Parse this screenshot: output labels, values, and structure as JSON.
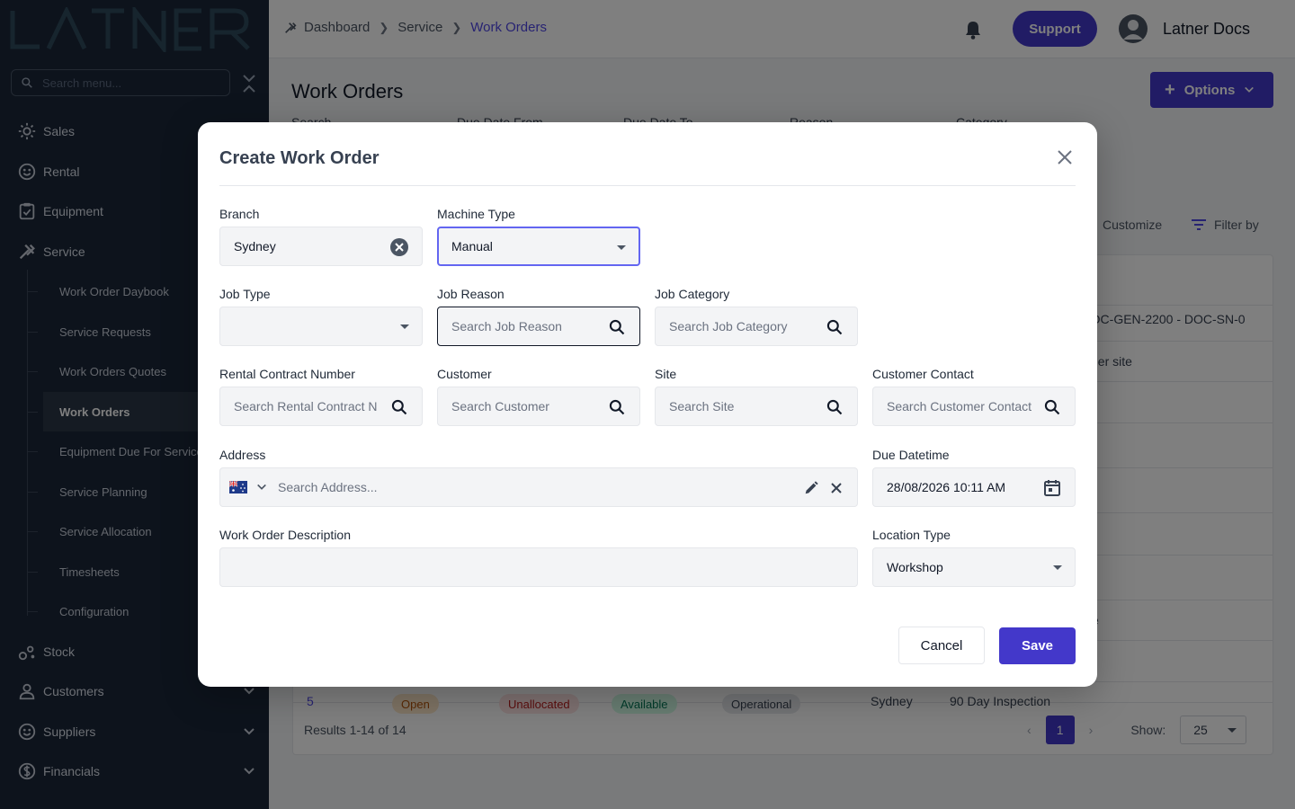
{
  "sidebar": {
    "logo_text": "LATNER",
    "search_placeholder": "Search menu...",
    "items": [
      {
        "label": "Sales",
        "icon": "gear-icon"
      },
      {
        "label": "Rental",
        "icon": "smile-icon"
      },
      {
        "label": "Equipment",
        "icon": "clipboard-icon"
      },
      {
        "label": "Service",
        "icon": "tools-icon"
      },
      {
        "label": "Stock",
        "icon": "boxes-icon"
      },
      {
        "label": "Customers",
        "icon": "person-icon"
      },
      {
        "label": "Suppliers",
        "icon": "smile-icon"
      },
      {
        "label": "Financials",
        "icon": "dollar-icon"
      }
    ],
    "service_sub_items": [
      {
        "label": "Work Order Daybook"
      },
      {
        "label": "Service Requests"
      },
      {
        "label": "Work Orders Quotes"
      },
      {
        "label": "Work Orders"
      },
      {
        "label": "Equipment Due For Service"
      },
      {
        "label": "Service Planning"
      },
      {
        "label": "Service Allocation"
      },
      {
        "label": "Timesheets"
      },
      {
        "label": "Configuration"
      }
    ]
  },
  "header": {
    "breadcrumb": [
      "Dashboard",
      "Service",
      "Work Orders"
    ],
    "support_label": "Support",
    "user_name": "Latner Docs"
  },
  "page": {
    "title": "Work Orders",
    "options_label": "Options",
    "filter_labels": [
      "Search",
      "Due Date From",
      "Due Date To",
      "Reason",
      "Category"
    ],
    "customize_label": "Customize",
    "filter_by_label": "Filter by",
    "bg_cells": [
      "- DOC-GEN-2200 - DOC-SN-0",
      "ner site",
      "e"
    ],
    "last_row": {
      "id": "5",
      "status": "Open",
      "allocation": "Unallocated",
      "availability": "Available",
      "condition": "Operational",
      "branch": "Sydney",
      "reason": "90 Day Inspection"
    },
    "results_text": "Results 1-14 of 14",
    "current_page": "1",
    "show_label": "Show:",
    "show_value": "25"
  },
  "modal": {
    "title": "Create Work Order",
    "fields": {
      "branch": {
        "label": "Branch",
        "value": "Sydney"
      },
      "machine_type": {
        "label": "Machine Type",
        "value": "Manual"
      },
      "job_type": {
        "label": "Job Type",
        "value": ""
      },
      "job_reason": {
        "label": "Job Reason",
        "placeholder": "Search Job Reason"
      },
      "job_category": {
        "label": "Job Category",
        "placeholder": "Search Job Category"
      },
      "rental_contract": {
        "label": "Rental Contract Number",
        "placeholder": "Search Rental Contract N"
      },
      "customer": {
        "label": "Customer",
        "placeholder": "Search Customer"
      },
      "site": {
        "label": "Site",
        "placeholder": "Search Site"
      },
      "customer_contact": {
        "label": "Customer Contact",
        "placeholder": "Search Customer Contact"
      },
      "address": {
        "label": "Address",
        "placeholder": "Search Address..."
      },
      "due_datetime": {
        "label": "Due Datetime",
        "value": "28/08/2026 10:11 AM"
      },
      "description": {
        "label": "Work Order Description",
        "value": ""
      },
      "location_type": {
        "label": "Location Type",
        "value": "Workshop"
      }
    },
    "cancel_label": "Cancel",
    "save_label": "Save"
  },
  "colors": {
    "accent": "#4338ca",
    "sidebar_bg": "#1a2638",
    "focus_border": "#6366f1"
  }
}
